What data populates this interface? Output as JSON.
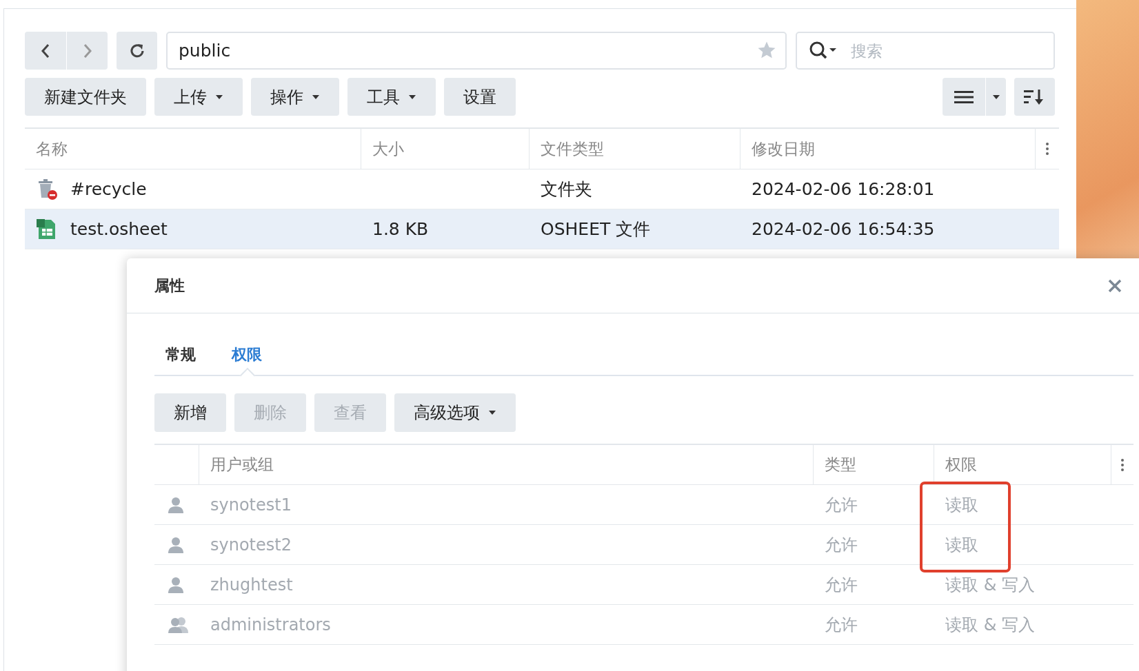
{
  "path_field": {
    "value": "public"
  },
  "search": {
    "placeholder": "搜索"
  },
  "toolbar_buttons": [
    {
      "label": "新建文件夹",
      "dropdown": false
    },
    {
      "label": "上传",
      "dropdown": true
    },
    {
      "label": "操作",
      "dropdown": true
    },
    {
      "label": "工具",
      "dropdown": true
    },
    {
      "label": "设置",
      "dropdown": false
    }
  ],
  "file_table": {
    "columns": [
      "名称",
      "大小",
      "文件类型",
      "修改日期"
    ],
    "rows": [
      {
        "kind": "recycle",
        "name": "#recycle",
        "size": "",
        "type": "文件夹",
        "modified": "2024-02-06 16:28:01",
        "selected": false
      },
      {
        "kind": "sheet",
        "name": "test.osheet",
        "size": "1.8 KB",
        "type": "OSHEET 文件",
        "modified": "2024-02-06 16:54:35",
        "selected": true
      }
    ]
  },
  "dialog": {
    "title": "属性",
    "tabs": [
      {
        "label": "常规",
        "selected": false
      },
      {
        "label": "权限",
        "selected": true
      }
    ],
    "buttons": [
      {
        "label": "新增",
        "disabled": false,
        "dropdown": false
      },
      {
        "label": "删除",
        "disabled": true,
        "dropdown": false
      },
      {
        "label": "查看",
        "disabled": true,
        "dropdown": false
      },
      {
        "label": "高级选项",
        "disabled": false,
        "dropdown": true
      }
    ],
    "table": {
      "columns": [
        "用户或组",
        "类型",
        "权限"
      ],
      "rows": [
        {
          "kind": "user",
          "name": "synotest1",
          "type": "允许",
          "permission": "读取",
          "highlighted": true
        },
        {
          "kind": "user",
          "name": "synotest2",
          "type": "允许",
          "permission": "读取",
          "highlighted": true
        },
        {
          "kind": "user",
          "name": "zhughtest",
          "type": "允许",
          "permission": "读取 & 写入",
          "highlighted": false
        },
        {
          "kind": "group",
          "name": "administrators",
          "type": "允许",
          "permission": "读取 & 写入",
          "highlighted": false
        }
      ]
    }
  }
}
